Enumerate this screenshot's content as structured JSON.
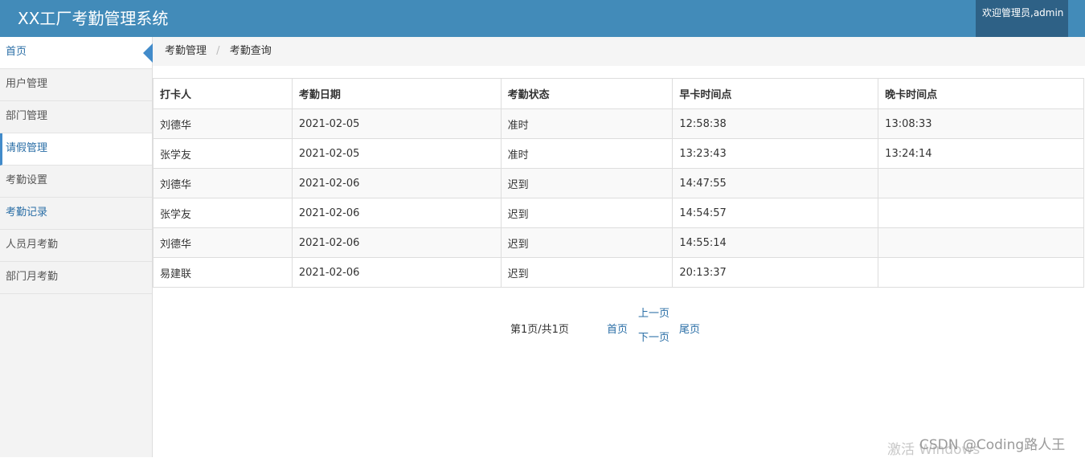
{
  "header": {
    "title": "XX工厂考勤管理系统",
    "user_greeting": "欢迎管理员,admin"
  },
  "sidebar": {
    "items": [
      {
        "label": "首页"
      },
      {
        "label": "用户管理"
      },
      {
        "label": "部门管理"
      },
      {
        "label": "请假管理"
      },
      {
        "label": "考勤设置"
      },
      {
        "label": "考勤记录"
      },
      {
        "label": "人员月考勤"
      },
      {
        "label": "部门月考勤"
      }
    ]
  },
  "breadcrumb": {
    "parent": "考勤管理",
    "separator": "/",
    "current": "考勤查询"
  },
  "table": {
    "columns": [
      "打卡人",
      "考勤日期",
      "考勤状态",
      "早卡时间点",
      "晚卡时间点"
    ],
    "rows": [
      [
        "刘德华",
        "2021-02-05",
        "准时",
        "12:58:38",
        "13:08:33"
      ],
      [
        "张学友",
        "2021-02-05",
        "准时",
        "13:23:43",
        "13:24:14"
      ],
      [
        "刘德华",
        "2021-02-06",
        "迟到",
        "14:47:55",
        ""
      ],
      [
        "张学友",
        "2021-02-06",
        "迟到",
        "14:54:57",
        ""
      ],
      [
        "刘德华",
        "2021-02-06",
        "迟到",
        "14:55:14",
        ""
      ],
      [
        "易建联",
        "2021-02-06",
        "迟到",
        "20:13:37",
        ""
      ]
    ]
  },
  "pagination": {
    "info": "第1页/共1页",
    "first": "首页",
    "prev": "上一页",
    "next": "下一页",
    "last": "尾页"
  },
  "overlay": {
    "activation_text": "激活 Windows",
    "watermark": "CSDN @Coding路人王"
  },
  "colors": {
    "header_bg": "#428bb9",
    "user_box_bg": "#2e6186",
    "link": "#2a6ea6"
  }
}
